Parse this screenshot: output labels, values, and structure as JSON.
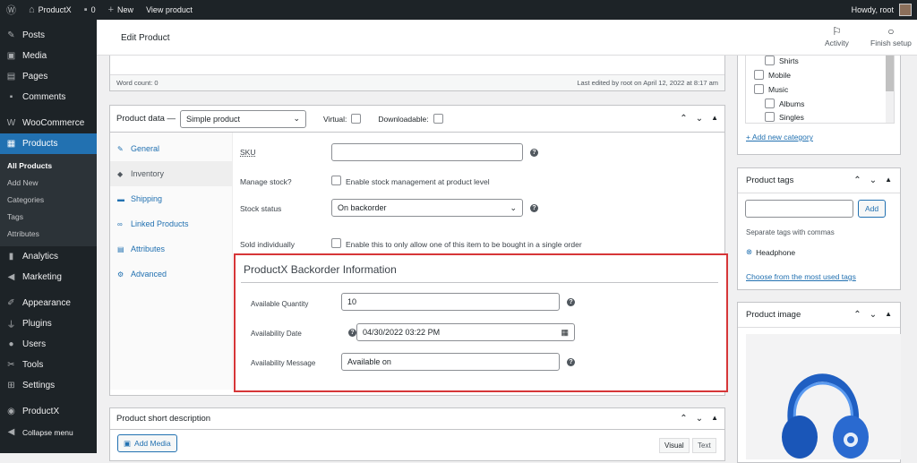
{
  "adminbar": {
    "site": "ProductX",
    "comments": "0",
    "new": "New",
    "view": "View product",
    "howdy": "Howdy, root"
  },
  "menu": {
    "items": [
      {
        "label": "Posts",
        "icon": "pin-icon"
      },
      {
        "label": "Media",
        "icon": "media-icon"
      },
      {
        "label": "Pages",
        "icon": "pages-icon"
      },
      {
        "label": "Comments",
        "icon": "comment-icon"
      },
      {
        "label": "WooCommerce",
        "icon": "woo-icon"
      },
      {
        "label": "Products",
        "icon": "products-icon"
      }
    ],
    "submenu": [
      "All Products",
      "Add New",
      "Categories",
      "Tags",
      "Attributes"
    ],
    "items2": [
      {
        "label": "Analytics",
        "icon": "analytics-icon"
      },
      {
        "label": "Marketing",
        "icon": "marketing-icon"
      },
      {
        "label": "Appearance",
        "icon": "appearance-icon"
      },
      {
        "label": "Plugins",
        "icon": "plugins-icon"
      },
      {
        "label": "Users",
        "icon": "users-icon"
      },
      {
        "label": "Tools",
        "icon": "tools-icon"
      },
      {
        "label": "Settings",
        "icon": "settings-icon"
      },
      {
        "label": "ProductX",
        "icon": "productx-icon"
      },
      {
        "label": "Collapse menu",
        "icon": "collapse-icon"
      }
    ]
  },
  "header": {
    "title": "Edit Product",
    "activity": "Activity",
    "finish": "Finish setup"
  },
  "editor": {
    "word_count": "Word count: 0",
    "last_edited": "Last edited by root on April 12, 2022 at 8:17 am"
  },
  "product_data": {
    "title": "Product data —",
    "type": "Simple product",
    "virtual": "Virtual:",
    "downloadable": "Downloadable:",
    "tabs": [
      "General",
      "Inventory",
      "Shipping",
      "Linked Products",
      "Attributes",
      "Advanced"
    ],
    "sku_label": "SKU",
    "sku_value": "",
    "manage_label": "Manage stock?",
    "manage_text": "Enable stock management at product level",
    "stock_label": "Stock status",
    "stock_value": "On backorder",
    "sold_label": "Sold individually",
    "sold_text": "Enable this to only allow one of this item to be bought in a single order"
  },
  "backorder": {
    "title": "ProductX Backorder Information",
    "qty_label": "Available Quantity",
    "qty_value": "10",
    "date_label": "Availability Date",
    "date_value": "04/30/2022  03:22  PM",
    "msg_label": "Availability Message",
    "msg_value": "Available on"
  },
  "short_desc": {
    "title": "Product short description",
    "add_media": "Add Media",
    "visual": "Visual",
    "text": "Text"
  },
  "categories": {
    "items": [
      "Shirts",
      "Mobile",
      "Music",
      "Albums",
      "Singles"
    ],
    "add": "+ Add new category"
  },
  "tags": {
    "title": "Product tags",
    "add": "Add",
    "hint": "Separate tags with commas",
    "tag": "Headphone",
    "choose": "Choose from the most used tags"
  },
  "image": {
    "title": "Product image"
  },
  "colors": {
    "accent": "#2271b1",
    "highlight": "#d63638",
    "admin": "#1d2327"
  }
}
